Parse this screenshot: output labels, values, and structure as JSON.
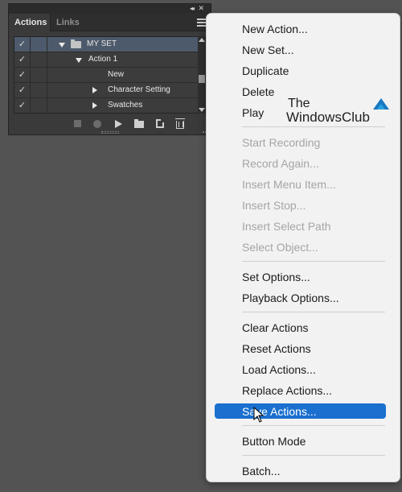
{
  "panel": {
    "tabs": [
      {
        "label": "Actions",
        "active": true
      },
      {
        "label": "Links",
        "active": false
      }
    ],
    "rows": [
      {
        "label": "MY SET",
        "checked": true,
        "expander": "down",
        "folder": true,
        "selected": true
      },
      {
        "label": "Action 1",
        "checked": true,
        "expander": "down",
        "folder": false,
        "selected": false
      },
      {
        "label": "New",
        "checked": true,
        "expander": "none",
        "folder": false,
        "selected": false
      },
      {
        "label": "Character Setting",
        "checked": true,
        "expander": "right",
        "folder": false,
        "selected": false
      },
      {
        "label": "Swatches",
        "checked": true,
        "expander": "right",
        "folder": false,
        "selected": false
      }
    ],
    "footer_icons": [
      "stop-icon",
      "record-icon",
      "play-icon",
      "new-set-icon",
      "new-action-icon",
      "trash-icon"
    ]
  },
  "menu": {
    "groups": [
      [
        "New Action...",
        "New Set...",
        "Duplicate",
        "Delete",
        "Play"
      ],
      [
        "Start Recording",
        "Record Again...",
        "Insert Menu Item...",
        "Insert Stop...",
        "Insert Select Path",
        "Select Object..."
      ],
      [
        "Set Options...",
        "Playback Options..."
      ],
      [
        "Clear Actions",
        "Reset Actions",
        "Load Actions...",
        "Replace Actions...",
        "Save Actions..."
      ],
      [
        "Button Mode"
      ],
      [
        "Batch..."
      ]
    ],
    "disabled_items": [
      "Start Recording",
      "Record Again...",
      "Insert Menu Item...",
      "Insert Stop...",
      "Insert Select Path",
      "Select Object..."
    ],
    "highlighted_item": "Save Actions...",
    "highlight_color": "#1a6fcf"
  },
  "watermark": {
    "line1": "The",
    "line2": "WindowsClub"
  },
  "colors": {
    "background": "#535353",
    "panel_bg": "#3a3a3a",
    "menu_bg": "#f2f2f2",
    "disabled_text": "#a5a5a5"
  }
}
